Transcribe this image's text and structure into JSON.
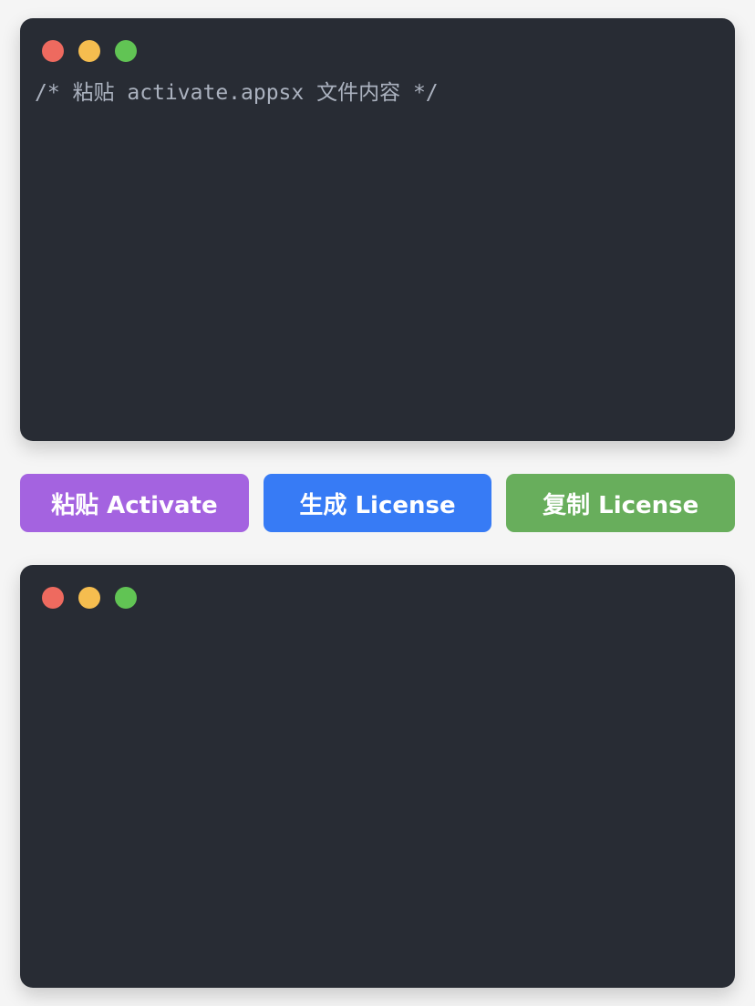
{
  "input_editor": {
    "placeholder": "/* 粘贴 activate.appsx 文件内容 */",
    "value": ""
  },
  "output_editor": {
    "value": ""
  },
  "window_controls": {
    "close_color": "#ee6a5f",
    "minimize_color": "#f5bd4f",
    "maximize_color": "#61c454"
  },
  "buttons": {
    "paste": {
      "label": "粘贴 Activate",
      "color": "#a463e0"
    },
    "generate": {
      "label": "生成 License",
      "color": "#377bf5"
    },
    "copy": {
      "label": "复制 License",
      "color": "#68ae5c"
    }
  },
  "theme": {
    "page_background": "#f5f5f5",
    "editor_background": "#282c34",
    "editor_text": "#abb2bf"
  }
}
